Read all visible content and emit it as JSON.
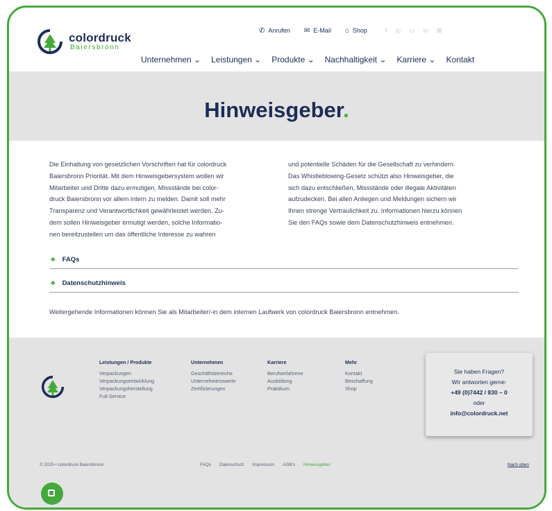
{
  "header": {
    "logo_name": "colordruck",
    "logo_sub": "Baiersbronn",
    "top_links": [
      {
        "label": "Anrufen",
        "icon": "phone-icon"
      },
      {
        "label": "E-Mail",
        "icon": "mail-icon"
      },
      {
        "label": "Shop",
        "icon": "shop-icon"
      }
    ],
    "social_icons": [
      "facebook-icon",
      "instagram-icon",
      "youtube-icon",
      "linkedin-icon",
      "xing-icon"
    ],
    "nav": [
      {
        "label": "Unternehmen ⌄"
      },
      {
        "label": "Leistungen ⌄"
      },
      {
        "label": "Produkte ⌄"
      },
      {
        "label": "Nachhaltigkeit ⌄"
      },
      {
        "label": "Karriere ⌄"
      },
      {
        "label": "Kontakt"
      }
    ]
  },
  "hero": {
    "title": "Hinweisgeber",
    "title_dot": "."
  },
  "body": {
    "col1_lines": [
      "Die Einhaltung von gesetzlichen Vorschriften hat für colordruck",
      "Baiersbronn Priorität. Mit dem Hinweisgebersystem wollen wir",
      "Mitarbeiter und Dritte dazu ermutigen, Missstände bei color-",
      "druck Baiersbronn vor allem intern zu melden. Damit soll mehr",
      "Transparenz und Verantwortlichkeit gewährleistet werden. Zu-",
      "dem sollen Hinweisgeber ermutigt werden, solche Informatio-",
      "nen bereitzustellen um das öffentliche Interesse zu wahren"
    ],
    "col2_lines": [
      "und potentielle Schäden für die Gesellschaft zu verhindern.",
      "Das Whistleblowing-Gesetz schützt also Hinweisgeber, die",
      "sich dazu entschließen, Missstände oder illegale Aktivitäten",
      "aufzudecken. Bei allen Anliegen und Meldungen sichern wir",
      "Ihnen strenge Vertraulichkeit zu. Informationen hierzu können",
      "Sie den FAQs sowie dem Datenschutzhinweis entnehmen."
    ],
    "accordions": [
      {
        "label": "FAQs",
        "icon": "tree-icon"
      },
      {
        "label": "Datenschutzhinweis",
        "icon": "tree-icon"
      }
    ],
    "more_info": "Weitergehende Informationen können Sie als Mitarbeiter/-in dem internen Laufwerk von colordruck Baiersbronn entnehmen."
  },
  "footer": {
    "columns": [
      {
        "heading": "Leistungen / Produkte",
        "items": [
          "Verpackungen",
          "Verpackungsentwicklung",
          "Verpackungsherstellung",
          "Full-Service"
        ]
      },
      {
        "heading": "Unternehmen",
        "items": [
          "Geschäftsbereiche",
          "Unternehmenswerte",
          "Zertifizierungen"
        ]
      },
      {
        "heading": "Karriere",
        "items": [
          "Berufserfahrene",
          "Ausbildung",
          "Praktikum"
        ]
      },
      {
        "heading": "Mehr",
        "items": [
          "Kontakt",
          "Beschaffung",
          "Shop"
        ]
      }
    ],
    "contact": {
      "line1": "Sie haben Fragen?",
      "line2": "Wir antworten gerne:",
      "phone": "+49 (0)7442 / 830 – 0",
      "or": "oder",
      "email": "info@colordruck.net"
    },
    "copyright": "© 2025 • colordruck Baiersbronn",
    "legal_links": [
      "FAQs",
      "Datenschutz",
      "Impressum",
      "AGB's",
      "Hinweisgeber"
    ],
    "back_to_top": "Nach oben"
  },
  "colors": {
    "brand_navy": "#1b2d57",
    "brand_green": "#45a83c",
    "band_gray": "#e3e3e3"
  }
}
